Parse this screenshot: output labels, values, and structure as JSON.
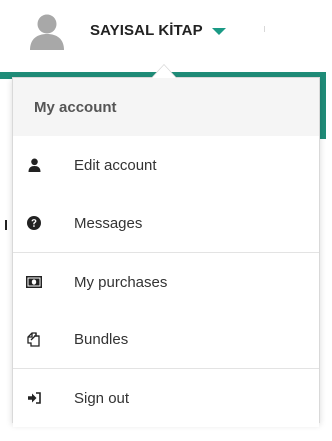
{
  "user": {
    "name": "SAYISAL KİTAP"
  },
  "menu": {
    "header": "My account",
    "items": [
      {
        "label": "Edit account",
        "icon": "user-icon"
      },
      {
        "label": "Messages",
        "icon": "question-circle-icon"
      },
      {
        "label": "My purchases",
        "icon": "money-icon"
      },
      {
        "label": "Bundles",
        "icon": "copy-icon"
      },
      {
        "label": "Sign out",
        "icon": "sign-out-icon"
      }
    ]
  },
  "colors": {
    "accent": "#1a9a85",
    "bar": "#1f8c78",
    "icon": "#222222"
  }
}
